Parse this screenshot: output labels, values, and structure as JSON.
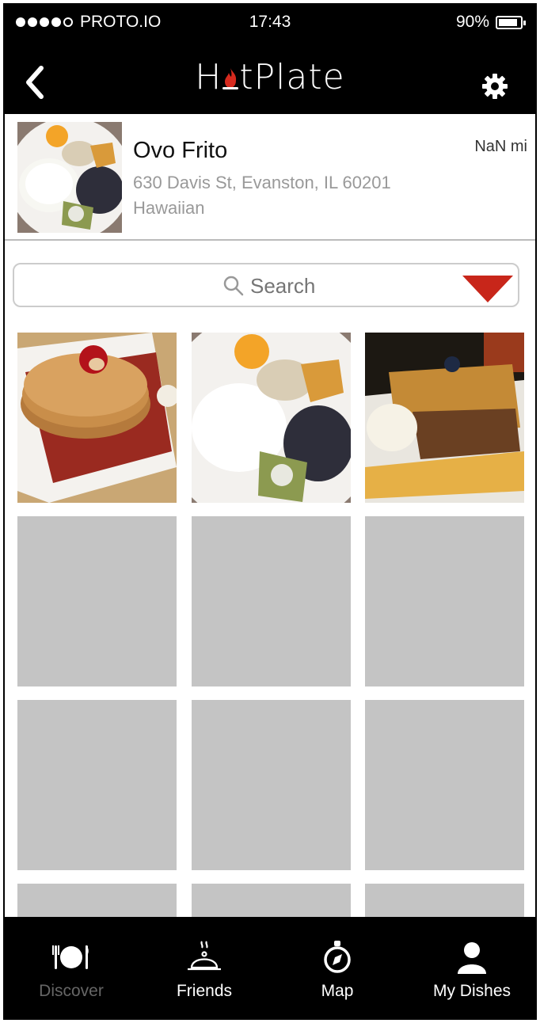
{
  "status_bar": {
    "carrier": "PROTO.IO",
    "time": "17:43",
    "battery": "90%",
    "battery_level": 0.9
  },
  "header": {
    "logo_left": "H",
    "logo_right": "tPlate",
    "back_icon": "chevron-left-icon",
    "settings_icon": "gear-icon"
  },
  "restaurant": {
    "name": "Ovo Frito",
    "address": "630 Davis St, Evanston, IL 60201",
    "cuisine": "Hawaiian",
    "distance": "NaN mi"
  },
  "search": {
    "placeholder": "Search",
    "icon": "search-icon",
    "dropdown_color": "#c8261a"
  },
  "photos": [
    {
      "kind": "pancakes"
    },
    {
      "kind": "eggs"
    },
    {
      "kind": "french-toast"
    },
    {
      "kind": "placeholder"
    },
    {
      "kind": "placeholder"
    },
    {
      "kind": "placeholder"
    },
    {
      "kind": "placeholder"
    },
    {
      "kind": "placeholder"
    },
    {
      "kind": "placeholder"
    },
    {
      "kind": "placeholder"
    },
    {
      "kind": "placeholder"
    },
    {
      "kind": "placeholder"
    }
  ],
  "tabs": [
    {
      "label": "Discover",
      "icon": "plate-cutlery-icon",
      "active": true
    },
    {
      "label": "Friends",
      "icon": "cloche-icon",
      "active": false
    },
    {
      "label": "Map",
      "icon": "compass-icon",
      "active": false
    },
    {
      "label": "My Dishes",
      "icon": "user-icon",
      "active": false
    }
  ]
}
